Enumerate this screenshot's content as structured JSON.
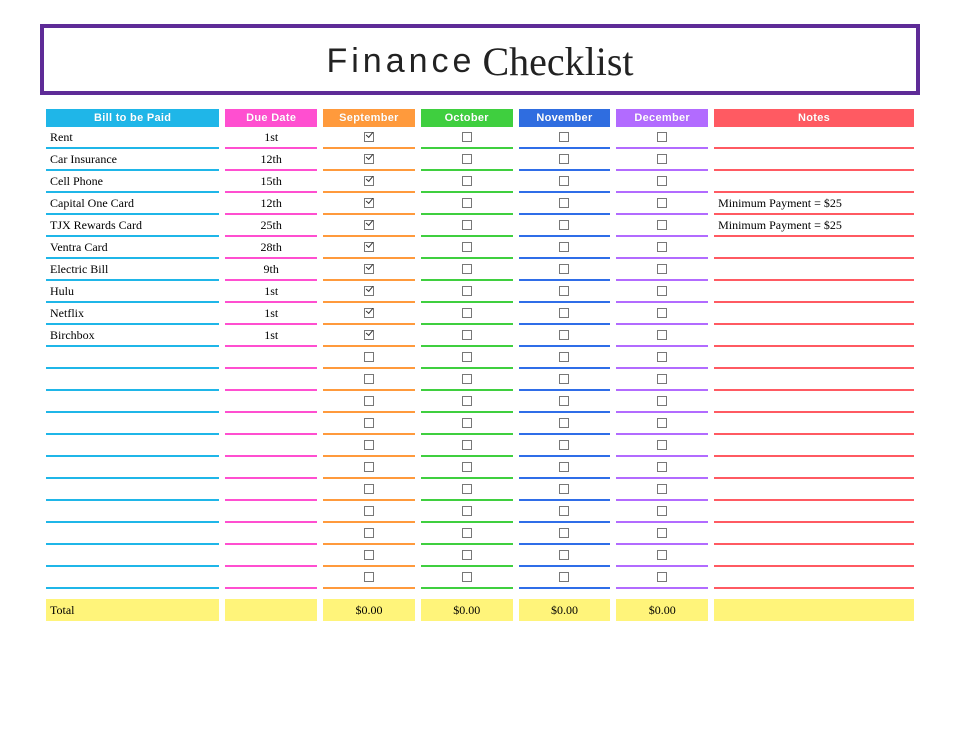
{
  "title": {
    "a": "Finance",
    "b": "Checklist"
  },
  "headers": {
    "bill": "Bill to be Paid",
    "due": "Due Date",
    "m1": "September",
    "m2": "October",
    "m3": "November",
    "m4": "December",
    "notes": "Notes"
  },
  "rows": [
    {
      "bill": "Rent",
      "due": "1st",
      "sep": true,
      "oct": false,
      "nov": false,
      "dec": false,
      "note": ""
    },
    {
      "bill": "Car Insurance",
      "due": "12th",
      "sep": true,
      "oct": false,
      "nov": false,
      "dec": false,
      "note": ""
    },
    {
      "bill": "Cell Phone",
      "due": "15th",
      "sep": true,
      "oct": false,
      "nov": false,
      "dec": false,
      "note": ""
    },
    {
      "bill": "Capital One Card",
      "due": "12th",
      "sep": true,
      "oct": false,
      "nov": false,
      "dec": false,
      "note": "Minimum Payment = $25"
    },
    {
      "bill": "TJX Rewards Card",
      "due": "25th",
      "sep": true,
      "oct": false,
      "nov": false,
      "dec": false,
      "note": "Minimum Payment = $25"
    },
    {
      "bill": "Ventra Card",
      "due": "28th",
      "sep": true,
      "oct": false,
      "nov": false,
      "dec": false,
      "note": ""
    },
    {
      "bill": "Electric Bill",
      "due": "9th",
      "sep": true,
      "oct": false,
      "nov": false,
      "dec": false,
      "note": ""
    },
    {
      "bill": "Hulu",
      "due": "1st",
      "sep": true,
      "oct": false,
      "nov": false,
      "dec": false,
      "note": ""
    },
    {
      "bill": "Netflix",
      "due": "1st",
      "sep": true,
      "oct": false,
      "nov": false,
      "dec": false,
      "note": ""
    },
    {
      "bill": "Birchbox",
      "due": "1st",
      "sep": true,
      "oct": false,
      "nov": false,
      "dec": false,
      "note": ""
    },
    {
      "bill": "",
      "due": "",
      "sep": false,
      "oct": false,
      "nov": false,
      "dec": false,
      "note": ""
    },
    {
      "bill": "",
      "due": "",
      "sep": false,
      "oct": false,
      "nov": false,
      "dec": false,
      "note": ""
    },
    {
      "bill": "",
      "due": "",
      "sep": false,
      "oct": false,
      "nov": false,
      "dec": false,
      "note": ""
    },
    {
      "bill": "",
      "due": "",
      "sep": false,
      "oct": false,
      "nov": false,
      "dec": false,
      "note": ""
    },
    {
      "bill": "",
      "due": "",
      "sep": false,
      "oct": false,
      "nov": false,
      "dec": false,
      "note": ""
    },
    {
      "bill": "",
      "due": "",
      "sep": false,
      "oct": false,
      "nov": false,
      "dec": false,
      "note": ""
    },
    {
      "bill": "",
      "due": "",
      "sep": false,
      "oct": false,
      "nov": false,
      "dec": false,
      "note": ""
    },
    {
      "bill": "",
      "due": "",
      "sep": false,
      "oct": false,
      "nov": false,
      "dec": false,
      "note": ""
    },
    {
      "bill": "",
      "due": "",
      "sep": false,
      "oct": false,
      "nov": false,
      "dec": false,
      "note": ""
    },
    {
      "bill": "",
      "due": "",
      "sep": false,
      "oct": false,
      "nov": false,
      "dec": false,
      "note": ""
    },
    {
      "bill": "",
      "due": "",
      "sep": false,
      "oct": false,
      "nov": false,
      "dec": false,
      "note": ""
    }
  ],
  "totals": {
    "label": "Total",
    "sep": "$0.00",
    "oct": "$0.00",
    "nov": "$0.00",
    "dec": "$0.00"
  }
}
